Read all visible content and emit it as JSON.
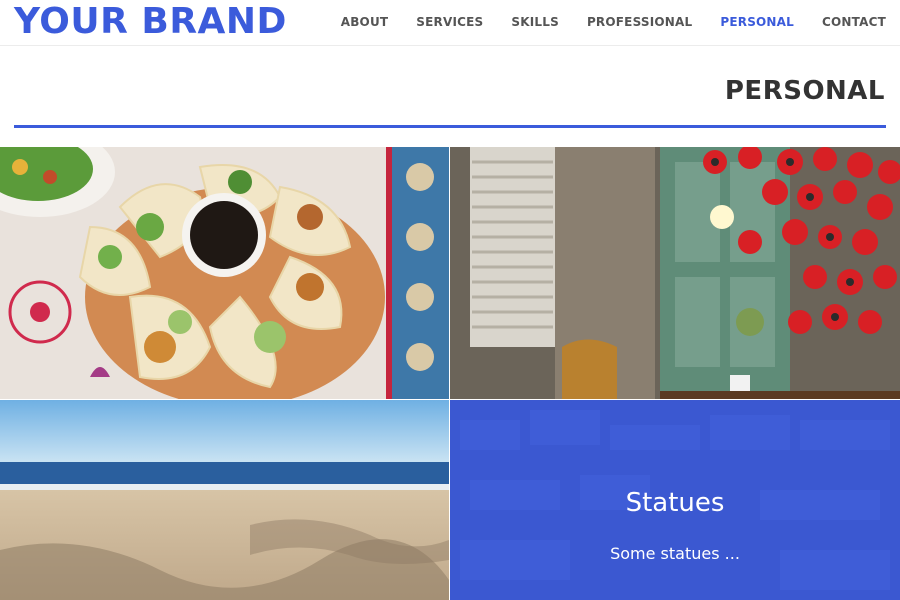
{
  "brand": "YOUR BRAND",
  "nav": {
    "items": [
      "ABOUT",
      "SERVICES",
      "SKILLS",
      "PROFESSIONAL",
      "PERSONAL",
      "CONTACT"
    ],
    "active": "PERSONAL"
  },
  "section": {
    "title": "PERSONAL"
  },
  "gallery": {
    "tiles": [
      {
        "subject": "tacos-food-photo"
      },
      {
        "subject": "cafe-red-megaphones-photo"
      },
      {
        "subject": "beach-photo"
      },
      {
        "subject": "statues-card",
        "title": "Statues",
        "description": "Some statues ..."
      }
    ]
  },
  "colors": {
    "accent": "#3b5bdb",
    "overlay": "#3b5be6",
    "nav_text": "#555555"
  }
}
